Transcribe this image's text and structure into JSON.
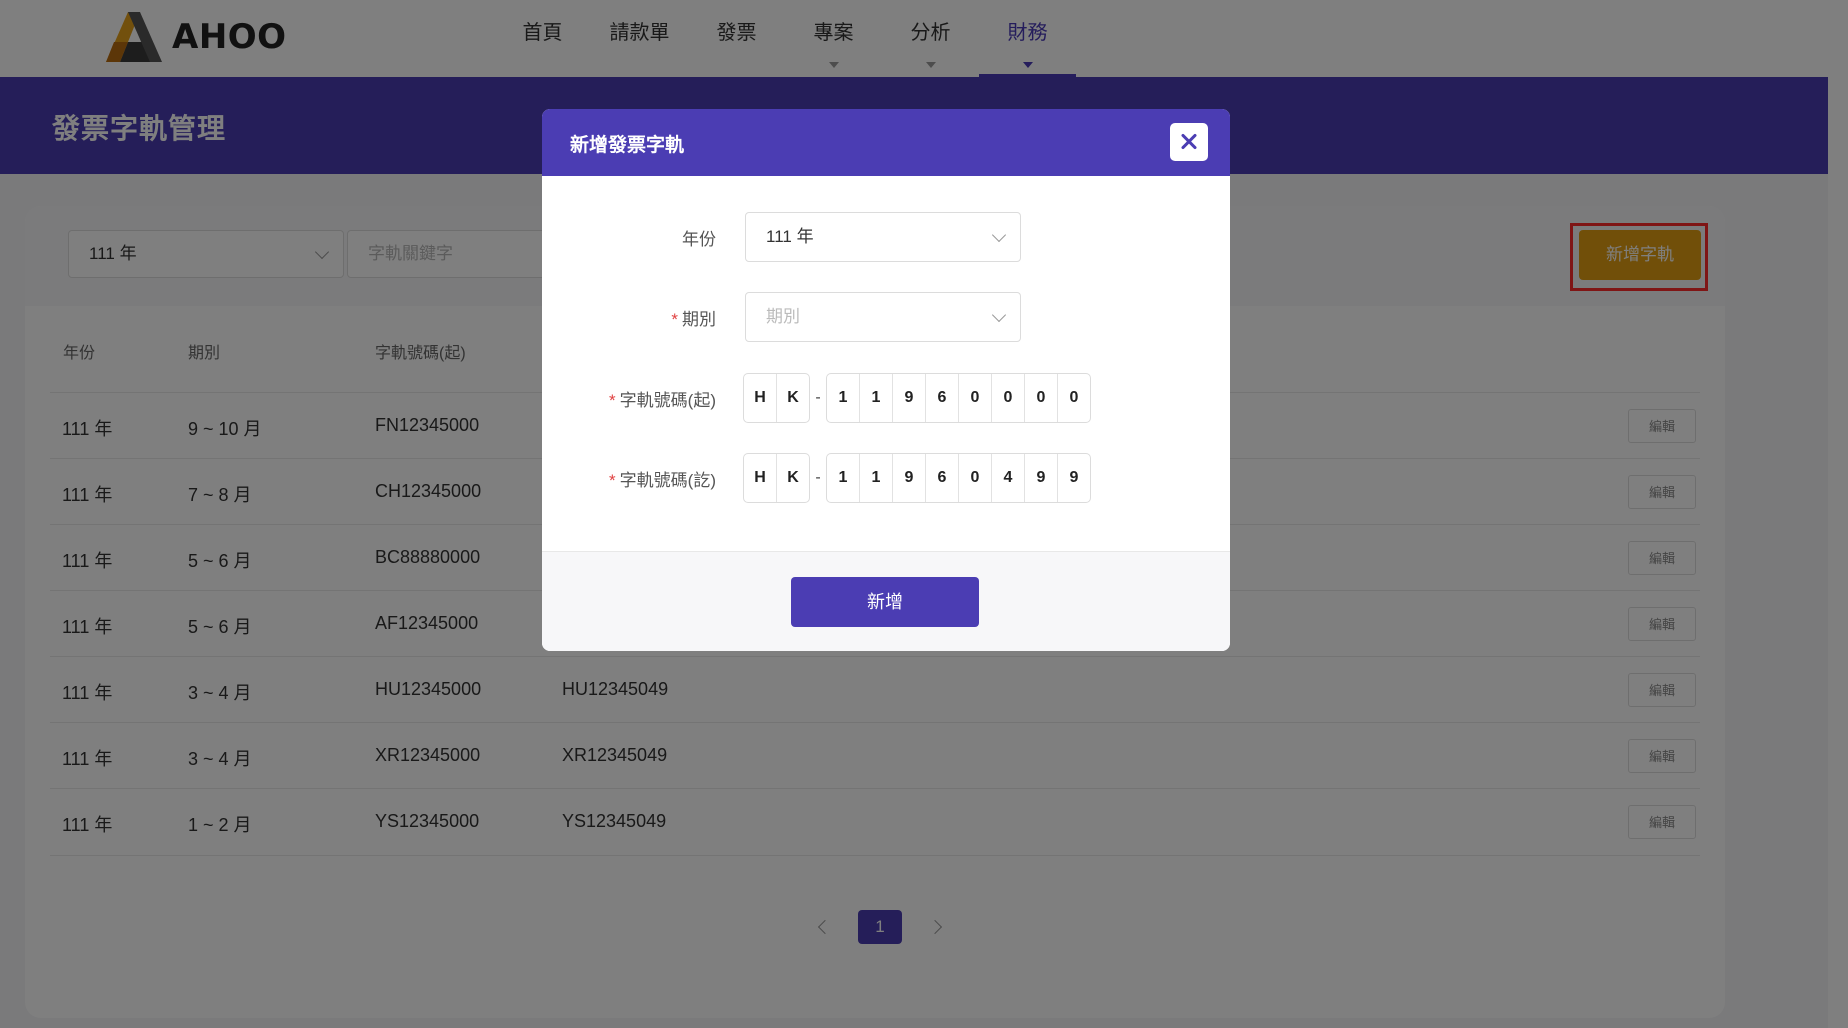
{
  "brand": {
    "name": "AHOO",
    "accent": "#4b3db3",
    "orange": "#e39f12"
  },
  "nav": {
    "items": [
      {
        "label": "首頁",
        "has_caret": false
      },
      {
        "label": "請款單",
        "has_caret": false
      },
      {
        "label": "發票",
        "has_caret": false
      },
      {
        "label": "專案",
        "has_caret": true
      },
      {
        "label": "分析",
        "has_caret": true
      },
      {
        "label": "財務",
        "has_caret": true,
        "active": true
      }
    ]
  },
  "page": {
    "title": "發票字軌管理"
  },
  "filters": {
    "year": "111 年",
    "keyword_placeholder": "字軌關鍵字",
    "add_button": "新增字軌"
  },
  "table": {
    "headers": [
      "年份",
      "期別",
      "字軌號碼(起)"
    ],
    "edit_label": "編輯",
    "rows": [
      {
        "year": "111 年",
        "period": "9 ~ 10 月",
        "start": "FN12345000",
        "end": ""
      },
      {
        "year": "111 年",
        "period": "7 ~ 8 月",
        "start": "CH12345000",
        "end": ""
      },
      {
        "year": "111 年",
        "period": "5 ~ 6 月",
        "start": "BC88880000",
        "end": ""
      },
      {
        "year": "111 年",
        "period": "5 ~ 6 月",
        "start": "AF12345000",
        "end": ""
      },
      {
        "year": "111 年",
        "period": "3 ~ 4 月",
        "start": "HU12345000",
        "end": "HU12345049"
      },
      {
        "year": "111 年",
        "period": "3 ~ 4 月",
        "start": "XR12345000",
        "end": "XR12345049"
      },
      {
        "year": "111 年",
        "period": "1 ~ 2 月",
        "start": "YS12345000",
        "end": "YS12345049"
      }
    ]
  },
  "pagination": {
    "current": "1"
  },
  "modal": {
    "title": "新增發票字軌",
    "year_label": "年份",
    "year_value": "111 年",
    "period_label": "期別",
    "period_placeholder": "期別",
    "start_label": "字軌號碼(起)",
    "end_label": "字軌號碼(訖)",
    "required_mark": "*",
    "dash": "-",
    "start_prefix": [
      "H",
      "K"
    ],
    "start_digits": [
      "1",
      "1",
      "9",
      "6",
      "0",
      "0",
      "0",
      "0"
    ],
    "end_prefix": [
      "H",
      "K"
    ],
    "end_digits": [
      "1",
      "1",
      "9",
      "6",
      "0",
      "4",
      "9",
      "9"
    ],
    "submit": "新增"
  }
}
